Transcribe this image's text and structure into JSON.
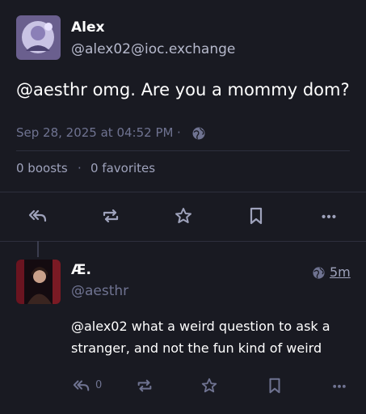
{
  "status": {
    "author": {
      "name": "Alex",
      "handle": "@alex02@ioc.exchange"
    },
    "content": "@aesthr omg. Are you a mommy dom?",
    "timestamp": "Sep 28, 2025 at 04:52 PM",
    "separator": "·",
    "boosts_label": "0 boosts",
    "favorites_label": "0 favorites",
    "visibility_icon": "globe-icon"
  },
  "actions": {
    "reply_icon": "reply-all-icon",
    "boost_icon": "boost-icon",
    "favorite_icon": "star-icon",
    "bookmark_icon": "bookmark-icon",
    "more_icon": "more-icon"
  },
  "reply": {
    "author": {
      "name": "Æ.",
      "handle": "@aesthr"
    },
    "age": "5m",
    "content_line1": "@alex02 what a weird question to ask a",
    "content_line2": "stranger, and not the fun kind of weird",
    "reply_count": "0"
  },
  "colors": {
    "background": "#191a22",
    "text": "#ffffff",
    "muted": "#6f7391",
    "secondary": "#b6b9cc",
    "icon": "#9ea2bb",
    "link": "#8c8dff"
  }
}
